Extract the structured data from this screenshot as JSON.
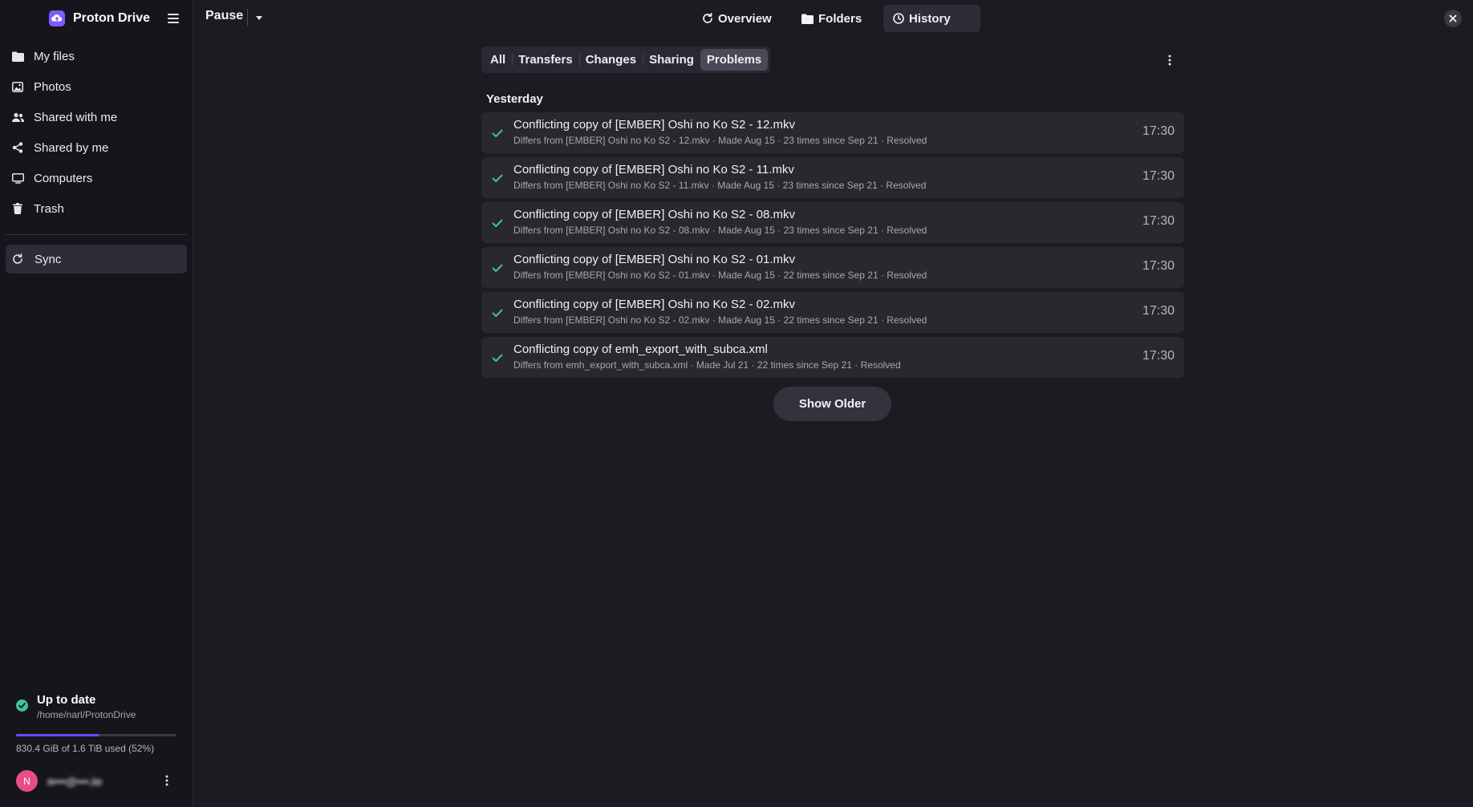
{
  "app": {
    "name": "Proton Drive"
  },
  "colors": {
    "accent": "#6d4aff",
    "success": "#3fc496",
    "avatar": "#e84d83"
  },
  "sidebar": {
    "items": [
      {
        "label": "My files",
        "icon": "folder-icon"
      },
      {
        "label": "Photos",
        "icon": "image-icon"
      },
      {
        "label": "Shared with me",
        "icon": "users-icon"
      },
      {
        "label": "Shared by me",
        "icon": "share-icon"
      },
      {
        "label": "Computers",
        "icon": "monitor-icon"
      },
      {
        "label": "Trash",
        "icon": "trash-icon"
      }
    ],
    "sync_label": "Sync"
  },
  "status": {
    "title": "Up to date",
    "path": "/home/narl/ProtonDrive",
    "usage_text": "830.4 GiB of 1.6 TiB used (52%)",
    "usage_fraction": 0.52
  },
  "account": {
    "initial": "N",
    "email": "n•••@•••.io"
  },
  "topbar": {
    "pause_label": "Pause",
    "tabs": [
      {
        "label": "Overview",
        "icon": "refresh-icon"
      },
      {
        "label": "Folders",
        "icon": "folder-icon"
      },
      {
        "label": "History",
        "icon": "clock-icon",
        "active": true
      }
    ]
  },
  "filters": [
    {
      "label": "All"
    },
    {
      "label": "Transfers"
    },
    {
      "label": "Changes"
    },
    {
      "label": "Sharing"
    },
    {
      "label": "Problems",
      "active": true
    }
  ],
  "history": {
    "section": "Yesterday",
    "rows": [
      {
        "title": "Conflicting copy of [EMBER] Oshi no Ko S2 - 12.mkv",
        "detail": "Differs from [EMBER] Oshi no Ko S2 - 12.mkv · Made Aug 15 · 23 times since Sep 21 · Resolved",
        "time": "17:30"
      },
      {
        "title": "Conflicting copy of [EMBER] Oshi no Ko S2 - 11.mkv",
        "detail": "Differs from [EMBER] Oshi no Ko S2 - 11.mkv · Made Aug 15 · 23 times since Sep 21 · Resolved",
        "time": "17:30"
      },
      {
        "title": "Conflicting copy of [EMBER] Oshi no Ko S2 - 08.mkv",
        "detail": "Differs from [EMBER] Oshi no Ko S2 - 08.mkv · Made Aug 15 · 23 times since Sep 21 · Resolved",
        "time": "17:30"
      },
      {
        "title": "Conflicting copy of [EMBER] Oshi no Ko S2 - 01.mkv",
        "detail": "Differs from [EMBER] Oshi no Ko S2 - 01.mkv · Made Aug 15 · 22 times since Sep 21 · Resolved",
        "time": "17:30"
      },
      {
        "title": "Conflicting copy of [EMBER] Oshi no Ko S2 - 02.mkv",
        "detail": "Differs from [EMBER] Oshi no Ko S2 - 02.mkv · Made Aug 15 · 22 times since Sep 21 · Resolved",
        "time": "17:30"
      },
      {
        "title": "Conflicting copy of emh_export_with_subca.xml",
        "detail": "Differs from emh_export_with_subca.xml · Made Jul 21 · 22 times since Sep 21 · Resolved",
        "time": "17:30"
      }
    ],
    "show_older_label": "Show Older"
  }
}
